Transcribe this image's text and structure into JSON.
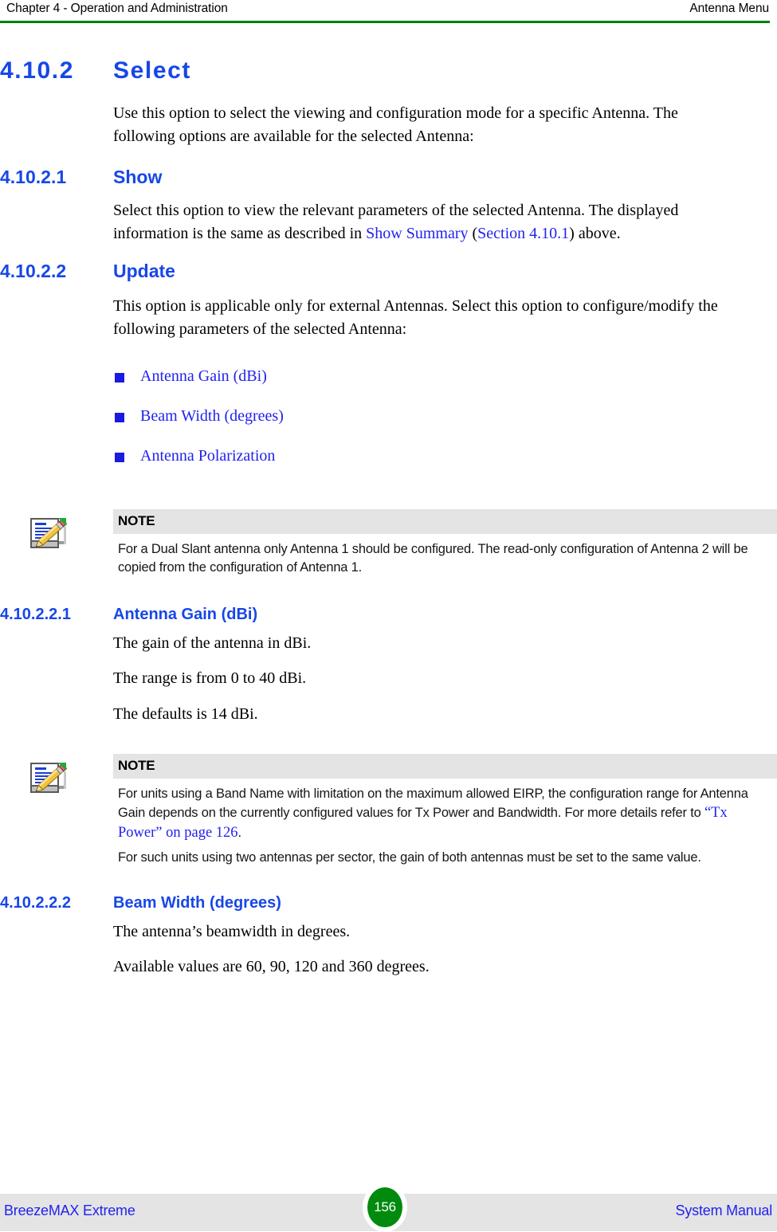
{
  "header": {
    "left": "Chapter 4 - Operation and Administration",
    "right": "Antenna Menu",
    "rule_color": "#008000"
  },
  "sections": {
    "select": {
      "number": "4.10.2",
      "title": "Select",
      "body": "Use this option to select the viewing and configuration mode for a specific Antenna. The following options are available for the selected Antenna:"
    },
    "show": {
      "number": "4.10.2.1",
      "title": "Show",
      "body_part1": "Select this option to view the relevant parameters of the selected Antenna. The displayed information is the same as described in ",
      "link1": "Show Summary",
      "body_part2": " (",
      "link2": "Section 4.10.1",
      "body_part3": ") above."
    },
    "update": {
      "number": "4.10.2.2",
      "title": "Update",
      "body": "This option is applicable only for external Antennas. Select this option to configure/modify the following parameters of the selected Antenna:",
      "bullets": [
        "Antenna Gain (dBi)",
        "Beam Width (degrees)",
        "Antenna Polarization"
      ]
    },
    "antenna_gain": {
      "number": "4.10.2.2.1",
      "title": "Antenna Gain (dBi)",
      "para1": "The gain of the antenna in dBi.",
      "para2": "The range is from 0 to 40 dBi.",
      "para3": "The defaults is 14 dBi."
    },
    "beam_width": {
      "number": "4.10.2.2.2",
      "title": "Beam Width (degrees)",
      "para1": "The antenna’s beamwidth in degrees.",
      "para2": "Available values are 60, 90, 120 and 360 degrees."
    }
  },
  "notes": [
    {
      "title": "NOTE",
      "icon": "note-pencil-icon",
      "paragraphs": [
        "For a Dual Slant antenna only Antenna 1 should be configured. The read-only configuration of Antenna 2 will be copied from the configuration of Antenna 1."
      ]
    },
    {
      "title": "NOTE",
      "icon": "note-pencil-icon",
      "para1_part1": "For units using a Band Name with limitation on the maximum allowed EIRP, the configuration range for Antenna Gain depends on the currently configured values for Tx Power and Bandwidth. For more details refer to ",
      "para1_link": "“Tx Power” on page 126",
      "para1_part2": ".",
      "para2": "For such units using two antennas per sector, the gain of both antennas must be set to the same value."
    }
  ],
  "footer": {
    "left": "BreezeMAX Extreme",
    "page_number": "156",
    "right": "System Manual",
    "badge_color": "#008a0e",
    "bar_color": "#e4e4e4"
  }
}
